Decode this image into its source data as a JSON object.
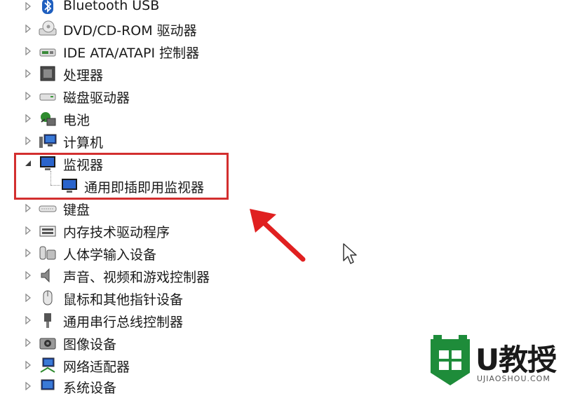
{
  "tree": {
    "items": [
      {
        "label": "Bluetooth USB",
        "icon": "bluetooth-icon",
        "expanded": false
      },
      {
        "label": "DVD/CD-ROM 驱动器",
        "icon": "optical-drive-icon",
        "expanded": false
      },
      {
        "label": "IDE ATA/ATAPI 控制器",
        "icon": "ide-controller-icon",
        "expanded": false
      },
      {
        "label": "处理器",
        "icon": "processor-icon",
        "expanded": false
      },
      {
        "label": "磁盘驱动器",
        "icon": "disk-drive-icon",
        "expanded": false
      },
      {
        "label": "电池",
        "icon": "battery-icon",
        "expanded": false
      },
      {
        "label": "计算机",
        "icon": "computer-icon",
        "expanded": false
      },
      {
        "label": "监视器",
        "icon": "monitor-icon",
        "expanded": true
      },
      {
        "label": "通用即插即用监视器",
        "icon": "monitor-icon",
        "child": true
      },
      {
        "label": "键盘",
        "icon": "keyboard-icon",
        "expanded": false
      },
      {
        "label": "内存技术驱动程序",
        "icon": "memory-icon",
        "expanded": false
      },
      {
        "label": "人体学输入设备",
        "icon": "hid-icon",
        "expanded": false
      },
      {
        "label": "声音、视频和游戏控制器",
        "icon": "speaker-icon",
        "expanded": false
      },
      {
        "label": "鼠标和其他指针设备",
        "icon": "mouse-icon",
        "expanded": false
      },
      {
        "label": "通用串行总线控制器",
        "icon": "usb-icon",
        "expanded": false
      },
      {
        "label": "图像设备",
        "icon": "camera-icon",
        "expanded": false
      },
      {
        "label": "网络适配器",
        "icon": "network-icon",
        "expanded": false
      },
      {
        "label": "系统设备",
        "icon": "system-device-icon",
        "expanded": false
      }
    ]
  },
  "annotation": {
    "highlight_color": "#d32f2f"
  },
  "watermark": {
    "brand": "U教授",
    "site": "UJIAOSHOU.COM",
    "brand_color": "#1e8c3a"
  }
}
